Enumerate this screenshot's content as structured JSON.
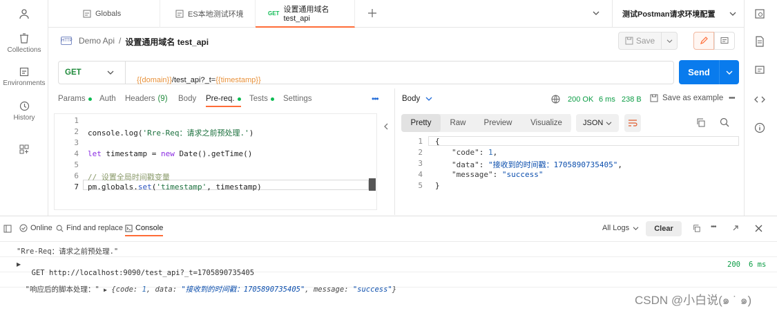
{
  "rail": {
    "items": [
      {
        "label": "Collections"
      },
      {
        "label": "Environments"
      },
      {
        "label": "History"
      }
    ]
  },
  "tabs": [
    {
      "label": "Globals"
    },
    {
      "label": "ES本地测试环境"
    },
    {
      "method": "GET",
      "label": "设置通用域名 test_api"
    }
  ],
  "env_selector": "测试Postman请求环境配置",
  "breadcrumb": {
    "parent": "Demo Api",
    "sep": "/",
    "current": "设置通用域名 test_api"
  },
  "save_label": "Save",
  "request": {
    "method": "GET",
    "url_parts": [
      "{{domain}}",
      "/test_api?_t=",
      "{{timestamp}}"
    ],
    "send_label": "Send"
  },
  "req_tabs": [
    {
      "label": "Params",
      "dot": true
    },
    {
      "label": "Auth"
    },
    {
      "label": "Headers",
      "count": "(9)"
    },
    {
      "label": "Body"
    },
    {
      "label": "Pre-req.",
      "dot": true
    },
    {
      "label": "Tests",
      "dot": true
    },
    {
      "label": "Settings"
    }
  ],
  "script_lines": [
    "1",
    "2",
    "3",
    "4",
    "5",
    "6",
    "7"
  ],
  "script": {
    "l2_a": "console.log(",
    "l2_b": "'Rre-Req：请求之前预处理.'",
    "l2_c": ")",
    "l4_let": "let",
    "l4_mid": " timestamp = ",
    "l4_new": "new",
    "l4_end": " Date().getTime()",
    "l6": "// 设置全局时间戳变量",
    "l7_a": "pm.globals.",
    "l7_set": "set",
    "l7_b": "(",
    "l7_str": "'timestamp'",
    "l7_c": ", timestamp)"
  },
  "response": {
    "body_label": "Body",
    "status": "200 OK",
    "time": "6 ms",
    "size": "238 B",
    "save_example": "Save as example",
    "views": [
      "Pretty",
      "Raw",
      "Preview",
      "Visualize"
    ],
    "format": "JSON",
    "lines": [
      "1",
      "2",
      "3",
      "4",
      "5"
    ],
    "json": {
      "open": "{",
      "code_key": "\"code\"",
      "code_val": "1",
      "data_key": "\"data\"",
      "data_val": "\"接收到的时间戳：1705890735405\"",
      "msg_key": "\"message\"",
      "msg_val": "\"success\"",
      "close": "}"
    }
  },
  "console_bar": {
    "online": "Online",
    "find": "Find and replace",
    "console": "Console",
    "all_logs": "All Logs",
    "clear": "Clear"
  },
  "console_logs": {
    "log1": "\"Rre-Req：请求之前预处理.\"",
    "log2_method": "GET",
    "log2_url": "http://localhost:9090/test_api?_t=1705890735405",
    "log2_status": "200",
    "log2_time": "6 ms",
    "log3_prefix": "\"响应后的脚本处理：\"",
    "log3_open": "{code: ",
    "log3_code": "1",
    "log3_mid": ", data: ",
    "log3_data": "\"接收到的时间戳：1705890735405\"",
    "log3_mid2": ", message: ",
    "log3_msg": "\"success\"",
    "log3_close": "}"
  },
  "watermark": "CSDN @小白说(๑ ˙ ๑)",
  "colors": {
    "accent": "#ff6c37",
    "send": "#097bed",
    "status_ok": "#0cbb52",
    "var": "#e8913a"
  }
}
